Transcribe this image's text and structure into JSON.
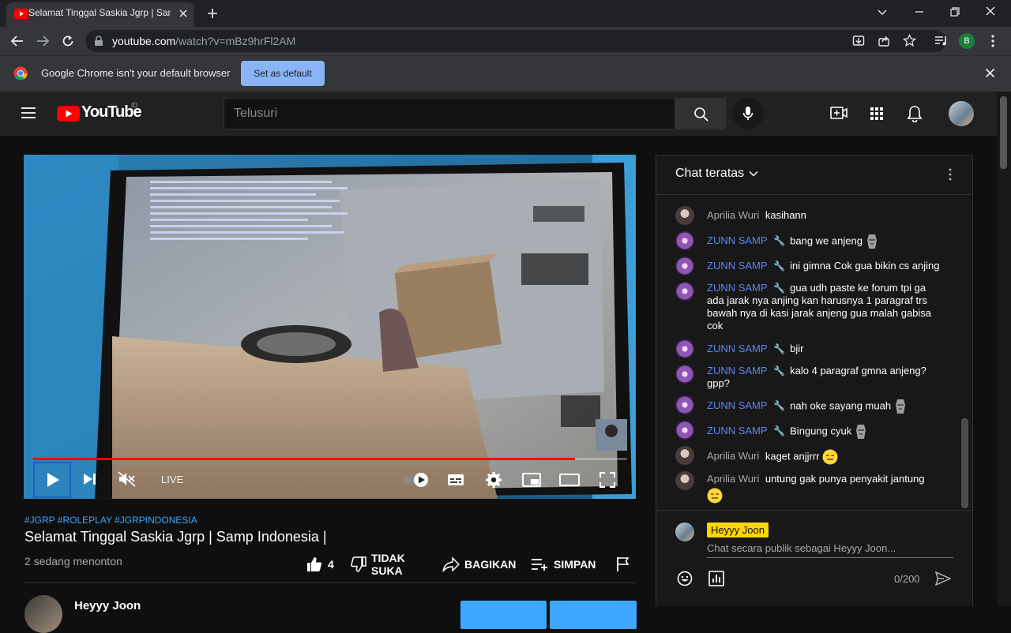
{
  "browser": {
    "tab_title": "Selamat Tinggal Saskia Jgrp | Samp Indonesia |",
    "url_host": "youtube.com",
    "url_path": "/watch?v=mBz9hrFl2AM",
    "profile_letter": "B",
    "infobar_text": "Google Chrome isn't your default browser",
    "set_default_label": "Set as default"
  },
  "header": {
    "logo_text": "YouTube",
    "region": "ID",
    "search_placeholder": "Telusuri"
  },
  "video": {
    "progress": 0.912,
    "live_label": "LIVE",
    "tags": "#JGRP #ROLEPLAY #JGRPINDONESIA",
    "title": "Selamat Tinggal Saskia Jgrp | Samp Indonesia |",
    "viewers": "2 sedang menonton",
    "likes": "4",
    "dislike_label_1": "TIDAK",
    "dislike_label_2": "SUKA",
    "share_label": "BAGIKAN",
    "save_label": "SIMPAN"
  },
  "channel": {
    "name": "Heyyy Joon"
  },
  "chat": {
    "title": "Chat teratas",
    "messages": [
      {
        "author": "Aprilia Wuri",
        "text": "kasihann",
        "mod": false
      },
      {
        "author": "ZUNN SAMP",
        "text": "bang we anjeng",
        "mod": true
      },
      {
        "author": "ZUNN SAMP",
        "text": "ini gimna Cok gua bikin cs anjing",
        "mod": true
      },
      {
        "author": "ZUNN SAMP",
        "text": "gua udh paste ke forum tpi ga ada jarak nya anjing kan harusnya 1 paragraf trs bawah nya di kasi jarak anjeng gua malah gabisa cok",
        "mod": true
      },
      {
        "author": "ZUNN SAMP",
        "text": "bjir",
        "mod": true
      },
      {
        "author": "ZUNN SAMP",
        "text": "kalo 4 paragraf gmna anjeng? gpp?",
        "mod": true
      },
      {
        "author": "ZUNN SAMP",
        "text": "nah oke sayang muah",
        "mod": true
      },
      {
        "author": "ZUNN SAMP",
        "text": "Bingung cyuk",
        "mod": true
      },
      {
        "author": "Aprilia Wuri",
        "text": "kaget anjjrrr",
        "mod": false
      },
      {
        "author": "Aprilia Wuri",
        "text": "untung gak punya penyakit jantung",
        "mod": false
      }
    ],
    "self_name": "Heyyy Joon",
    "input_placeholder": "Chat secara publik sebagai Heyyy Joon...",
    "char_count": "0/200"
  },
  "colors": {
    "accent_red": "#ff0000",
    "link_blue": "#3ea6ff",
    "moderator_blue": "#5e84f1",
    "self_badge": "#ffd600"
  }
}
